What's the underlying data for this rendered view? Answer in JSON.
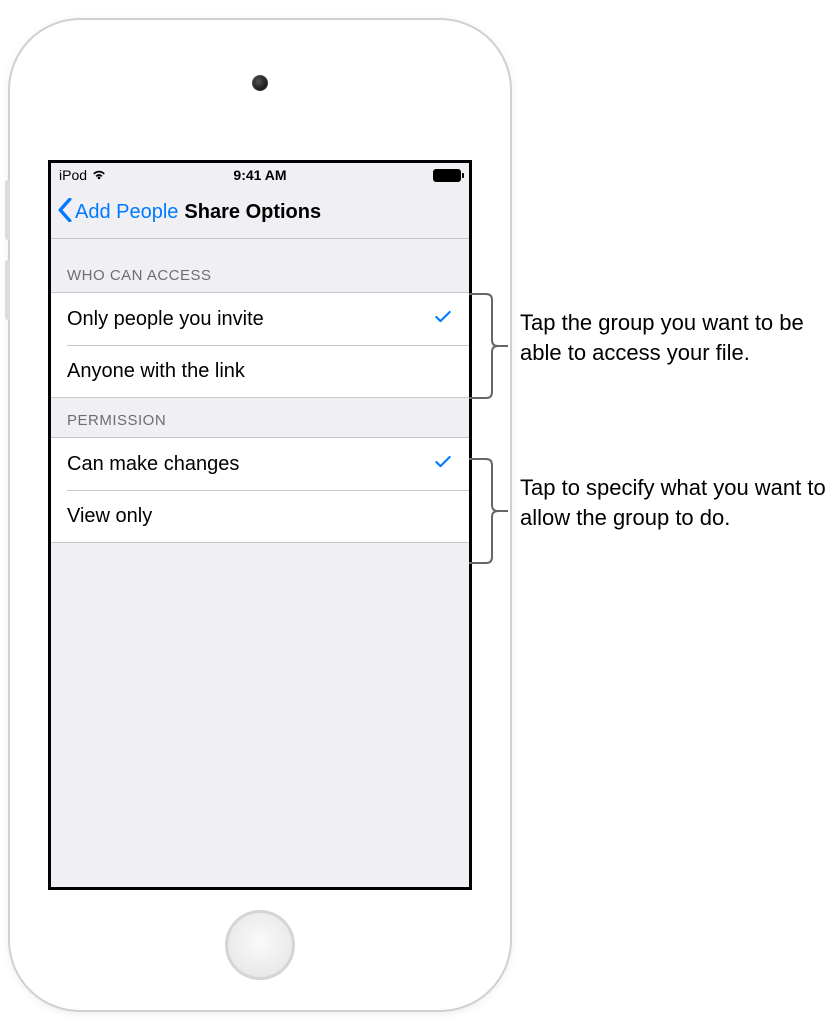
{
  "status": {
    "carrier": "iPod",
    "time": "9:41 AM"
  },
  "nav": {
    "back_label": "Add People",
    "title": "Share Options"
  },
  "sections": {
    "access": {
      "header": "Who Can Access",
      "options": [
        {
          "label": "Only people you invite",
          "selected": true
        },
        {
          "label": "Anyone with the link",
          "selected": false
        }
      ]
    },
    "permission": {
      "header": "Permission",
      "options": [
        {
          "label": "Can make changes",
          "selected": true
        },
        {
          "label": "View only",
          "selected": false
        }
      ]
    }
  },
  "callouts": {
    "access": "Tap the group you want to be able to access your file.",
    "permission": "Tap to specify what you want to allow the group to do."
  }
}
